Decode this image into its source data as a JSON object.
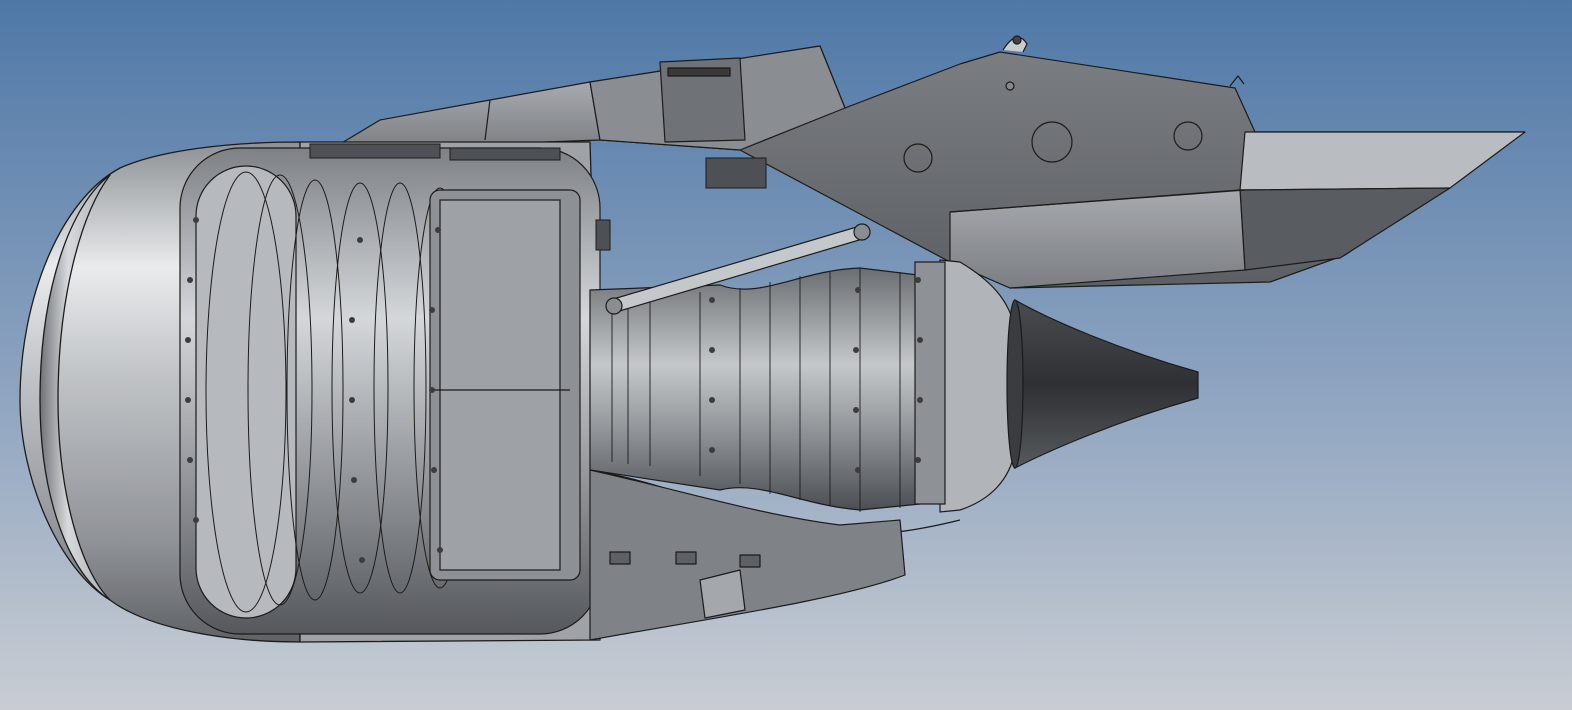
{
  "scene": {
    "background_top": "#4f78a7",
    "background_bottom": "#c7ccd3",
    "metal_light": "#d9dcdf",
    "metal_mid": "#9a9ea3",
    "metal_dark": "#5d6065",
    "pylon_color": "#6c6e72",
    "outline_color": "#1b1b1b"
  },
  "parts": {
    "fan_cowl": "nacelle-fan-cowl",
    "fan_case": "fan-case",
    "core_engine": "core-engine",
    "turbine_case": "turbine-case",
    "exhaust_cone": "exhaust-cone",
    "pylon": "engine-pylon",
    "strut": "thrust-link-strut"
  }
}
